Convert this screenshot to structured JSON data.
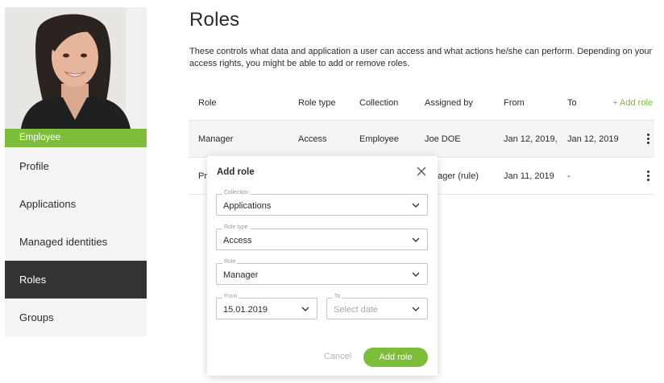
{
  "sidebar": {
    "user_type_badge": "Employee",
    "items": [
      {
        "label": "Profile"
      },
      {
        "label": "Applications"
      },
      {
        "label": "Managed identities"
      },
      {
        "label": "Roles"
      },
      {
        "label": "Groups"
      }
    ],
    "active_item": "Roles"
  },
  "main": {
    "title": "Roles",
    "description": "These controls what data and application a user can access and what actions he/she can perform. Depending on your access rights, you might be able to add or remove roles.",
    "table": {
      "columns": [
        "Role",
        "Role type",
        "Collection",
        "Assigned by",
        "From",
        "To"
      ],
      "add_role_link": "+ Add role",
      "rows": [
        {
          "role": "Manager",
          "role_type": "Access",
          "collection": "Employee",
          "assigned_by": "Joe DOE",
          "from": "Jan 12, 2019,",
          "to": "Jan 12, 2019"
        },
        {
          "role": "Pr",
          "role_type": "",
          "collection": "",
          "assigned_by": "nager (rule)",
          "from": "Jan 11, 2019",
          "to": "-"
        }
      ]
    }
  },
  "modal": {
    "title": "Add role",
    "fields": {
      "collection": {
        "label": "Collection",
        "value": "Applications"
      },
      "role_type": {
        "label": "Role type",
        "value": "Access"
      },
      "role": {
        "label": "Role",
        "value": "Manager"
      },
      "from": {
        "label": "From",
        "value": "15.01.2019"
      },
      "to": {
        "label": "To",
        "placeholder": "Select date"
      }
    },
    "cancel_label": "Cancel",
    "submit_label": "Add role"
  },
  "colors": {
    "accent": "#7cbd3a",
    "active_nav": "#333333"
  },
  "icons": [
    "close-icon",
    "chevron-down-icon",
    "more-vertical-icon"
  ]
}
